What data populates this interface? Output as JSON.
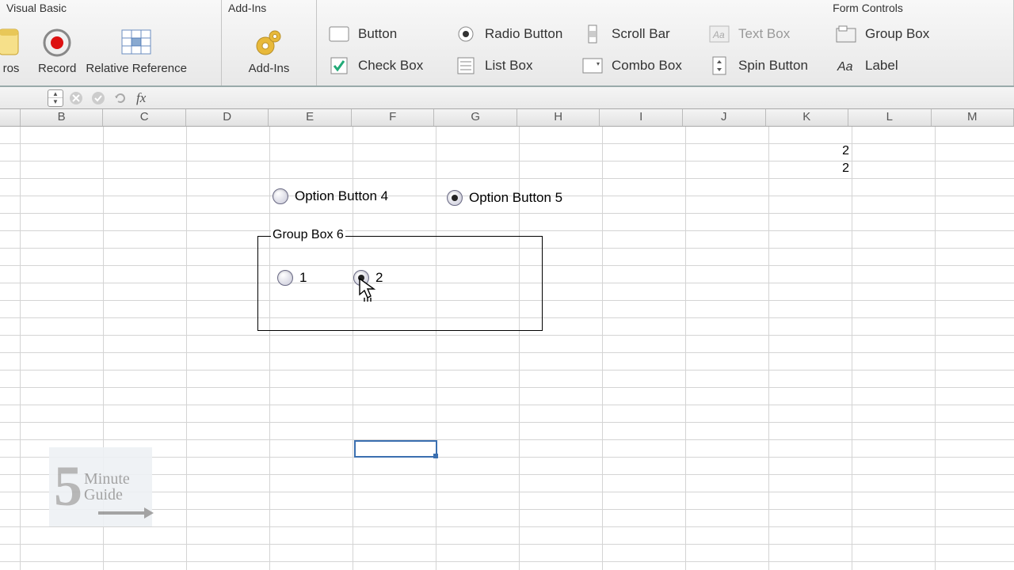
{
  "ribbon": {
    "group_vb": {
      "title": "Visual Basic",
      "macros_label": "ros",
      "record_label": "Record",
      "relref_label": "Relative Reference"
    },
    "group_addins": {
      "title": "Add-Ins",
      "addins_label": "Add-Ins"
    },
    "group_formcontrols": {
      "title": "Form Controls",
      "button_label": "Button",
      "radio_label": "Radio Button",
      "scroll_label": "Scroll Bar",
      "textbox_label": "Text Box",
      "groupbox_label": "Group Box",
      "checkbox_label": "Check Box",
      "listbox_label": "List Box",
      "combobox_label": "Combo Box",
      "spin_label": "Spin Button",
      "label_label": "Label"
    }
  },
  "formula_bar": {
    "fx_label": "fx",
    "value": ""
  },
  "columns": [
    "B",
    "C",
    "D",
    "E",
    "F",
    "G",
    "H",
    "I",
    "J",
    "K",
    "L",
    "M"
  ],
  "cells": {
    "K2": "2",
    "K3": "2"
  },
  "canvas": {
    "opt4": "Option Button 4",
    "opt5": "Option Button 5",
    "groupbox_label": "Group Box 6",
    "opt1": "1",
    "opt2": "2"
  },
  "watermark": {
    "big": "5",
    "line1": "Minute",
    "line2": "Guide"
  }
}
